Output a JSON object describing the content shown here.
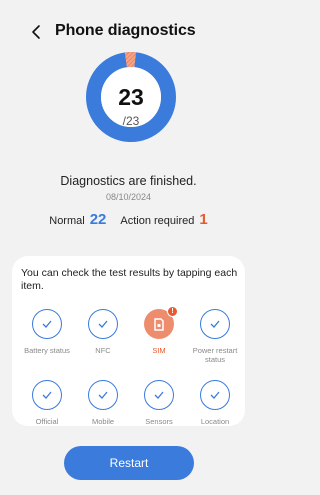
{
  "header": {
    "title": "Phone diagnostics",
    "back_icon": "chevron-left-icon"
  },
  "summary": {
    "passed_count": "23",
    "total_label": "/23",
    "passed_fraction": 0.96,
    "status_text": "Diagnostics are finished.",
    "date": "08/10/2024",
    "normal_label": "Normal",
    "normal_count": "22",
    "action_label": "Action required",
    "action_count": "1"
  },
  "results": {
    "intro": "You can check the test results by tapping each item.",
    "items": [
      {
        "label": "Battery status",
        "state": "normal",
        "icon": "checkmark-icon"
      },
      {
        "label": "NFC",
        "state": "normal",
        "icon": "checkmark-icon"
      },
      {
        "label": "SIM",
        "state": "action-required",
        "icon": "sim-card-icon"
      },
      {
        "label": "Power restart status",
        "state": "normal",
        "icon": "checkmark-icon"
      },
      {
        "label": "Official",
        "state": "normal",
        "icon": "checkmark-icon"
      },
      {
        "label": "Mobile",
        "state": "normal",
        "icon": "checkmark-icon"
      },
      {
        "label": "Sensors",
        "state": "normal",
        "icon": "checkmark-icon"
      },
      {
        "label": "Location",
        "state": "normal",
        "icon": "checkmark-icon"
      }
    ],
    "badge_icon": "exclamation-icon"
  },
  "actions": {
    "restart_label": "Restart"
  },
  "colors": {
    "accent": "#3a7bdc",
    "warning": "#e8592d",
    "warning_light": "#ee8d6e",
    "background": "#f2f2f2"
  }
}
